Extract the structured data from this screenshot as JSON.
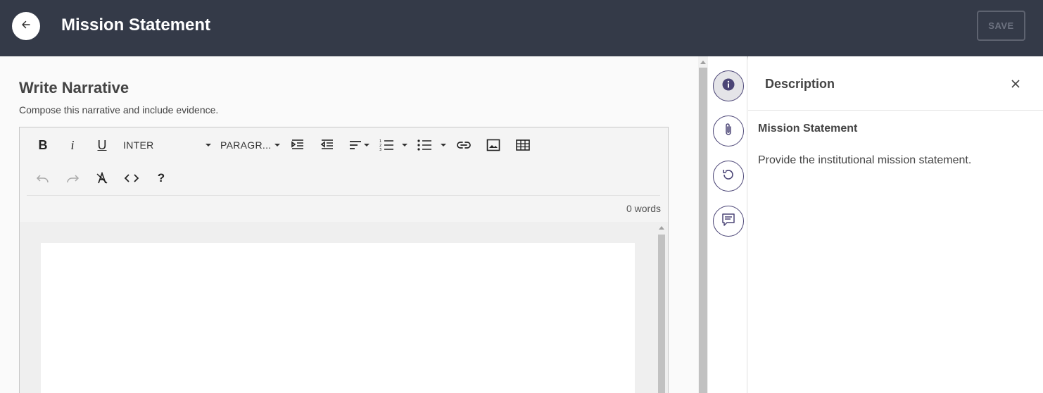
{
  "header": {
    "title": "Mission Statement",
    "save_label": "SAVE"
  },
  "narrative": {
    "title": "Write Narrative",
    "subtitle": "Compose this narrative and include evidence."
  },
  "toolbar": {
    "font_family": "INTER",
    "block_format": "PARAGR...",
    "help_label": "?",
    "word_count": "0 words"
  },
  "description_panel": {
    "title": "Description",
    "heading": "Mission Statement",
    "text": "Provide the institutional mission statement."
  },
  "colors": {
    "header_bg": "#343a48",
    "accent": "#4b4576",
    "background": "#fafafa"
  },
  "icons": {
    "back": "arrow-left-icon",
    "info": "info-icon",
    "attachment": "paperclip-icon",
    "history": "history-icon",
    "comments": "comment-icon",
    "close": "close-icon"
  }
}
